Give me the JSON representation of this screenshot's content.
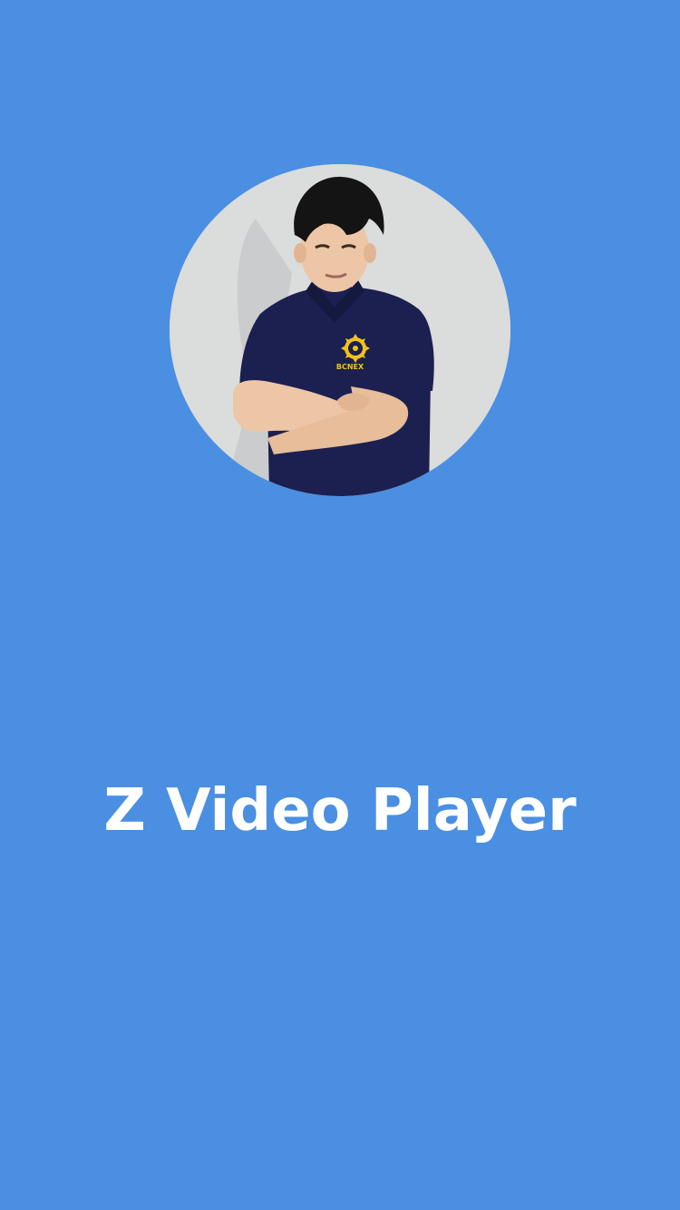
{
  "splash": {
    "app_title": "Z Video Player",
    "background_color": "#4a8fe2",
    "avatar": {
      "icon": "profile-photo",
      "shirt_logo_text": "BCNEX",
      "shirt_color": "#1a1f4e",
      "logo_color": "#f2c21b"
    }
  }
}
